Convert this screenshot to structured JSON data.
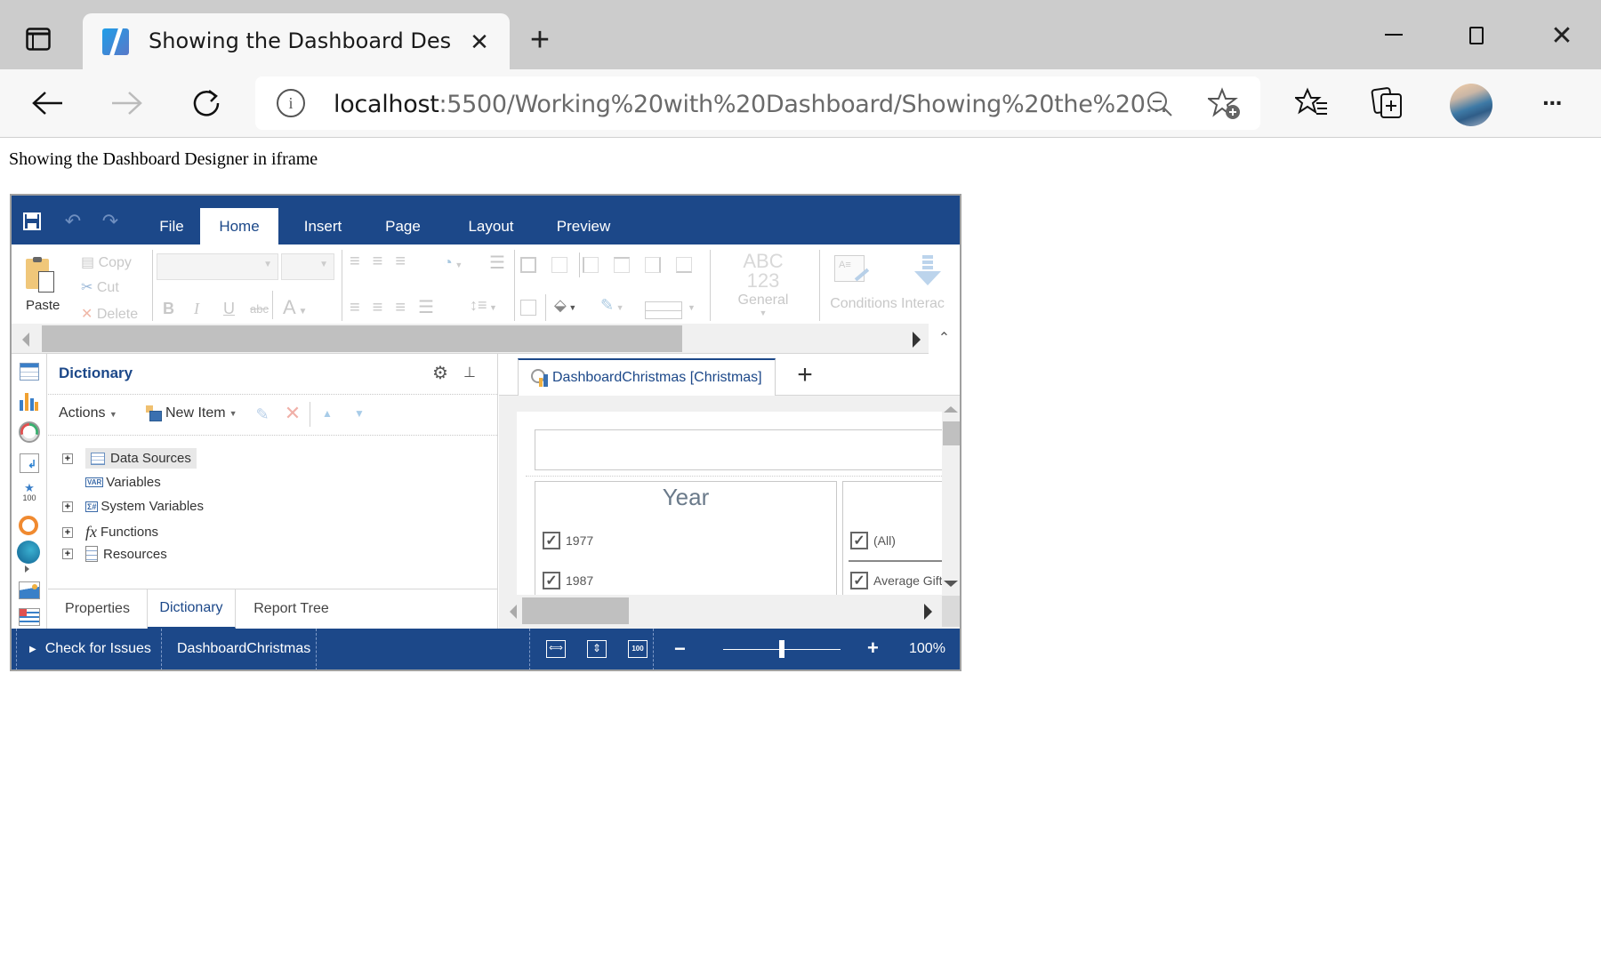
{
  "browser": {
    "tab_title": "Showing the Dashboard Designer in iframe",
    "url_host": "localhost",
    "url_path": ":5500/Working%20with%20Dashboard/Showing%20the%20...",
    "icons": [
      "sidebar-icon",
      "back-icon",
      "forward-icon",
      "refresh-icon",
      "info-icon",
      "zoom-out-icon",
      "add-favorite-icon",
      "favorites-icon",
      "collections-icon",
      "profile-avatar",
      "more-icon",
      "minimize-icon",
      "maximize-icon",
      "close-icon",
      "new-tab-icon",
      "tab-close-icon"
    ]
  },
  "page": {
    "heading": "Showing the Dashboard Designer in iframe"
  },
  "designer": {
    "menu_tabs": [
      {
        "label": "File",
        "active": false
      },
      {
        "label": "Home",
        "active": true
      },
      {
        "label": "Insert",
        "active": false
      },
      {
        "label": "Page",
        "active": false
      },
      {
        "label": "Layout",
        "active": false
      },
      {
        "label": "Preview",
        "active": false
      }
    ],
    "ribbon": {
      "paste": "Paste",
      "copy": "Copy",
      "cut": "Cut",
      "delete": "Delete",
      "format_abc": "ABC",
      "format_123": "123",
      "format_label": "General",
      "conditions": "Conditions",
      "interaction": "Interac",
      "bold": "B",
      "italic": "I",
      "underline": "U",
      "strike": "abc",
      "font_color": "A"
    },
    "dictionary": {
      "title": "Dictionary",
      "actions": "Actions",
      "new_item": "New Item",
      "tree": [
        {
          "label": "Data Sources",
          "expandable": true,
          "icon": "data-sources-icon",
          "selected": true
        },
        {
          "label": "Variables",
          "expandable": false,
          "icon": "variables-icon",
          "selected": false
        },
        {
          "label": "System Variables",
          "expandable": true,
          "icon": "system-variables-icon",
          "selected": false
        },
        {
          "label": "Functions",
          "expandable": true,
          "icon": "functions-icon",
          "selected": false
        },
        {
          "label": "Resources",
          "expandable": true,
          "icon": "resources-icon",
          "selected": false
        }
      ],
      "bottom_tabs": [
        {
          "label": "Properties",
          "active": false
        },
        {
          "label": "Dictionary",
          "active": true
        },
        {
          "label": "Report Tree",
          "active": false
        }
      ]
    },
    "document_tab": "DashboardChristmas [Christmas]",
    "canvas": {
      "year_title": "Year",
      "year_items": [
        "1977",
        "1987"
      ],
      "filter_items": [
        "(All)",
        "Average Gift"
      ]
    },
    "status": {
      "check_issues": "Check for Issues",
      "report_name": "DashboardChristmas",
      "zoom_minus": "−",
      "zoom_plus": "+",
      "zoom_level": "100%",
      "zoom_fraction": 0.5
    },
    "colors": {
      "brand": "#1c4889",
      "ribbon_disabled": "#c8c8c8"
    }
  }
}
